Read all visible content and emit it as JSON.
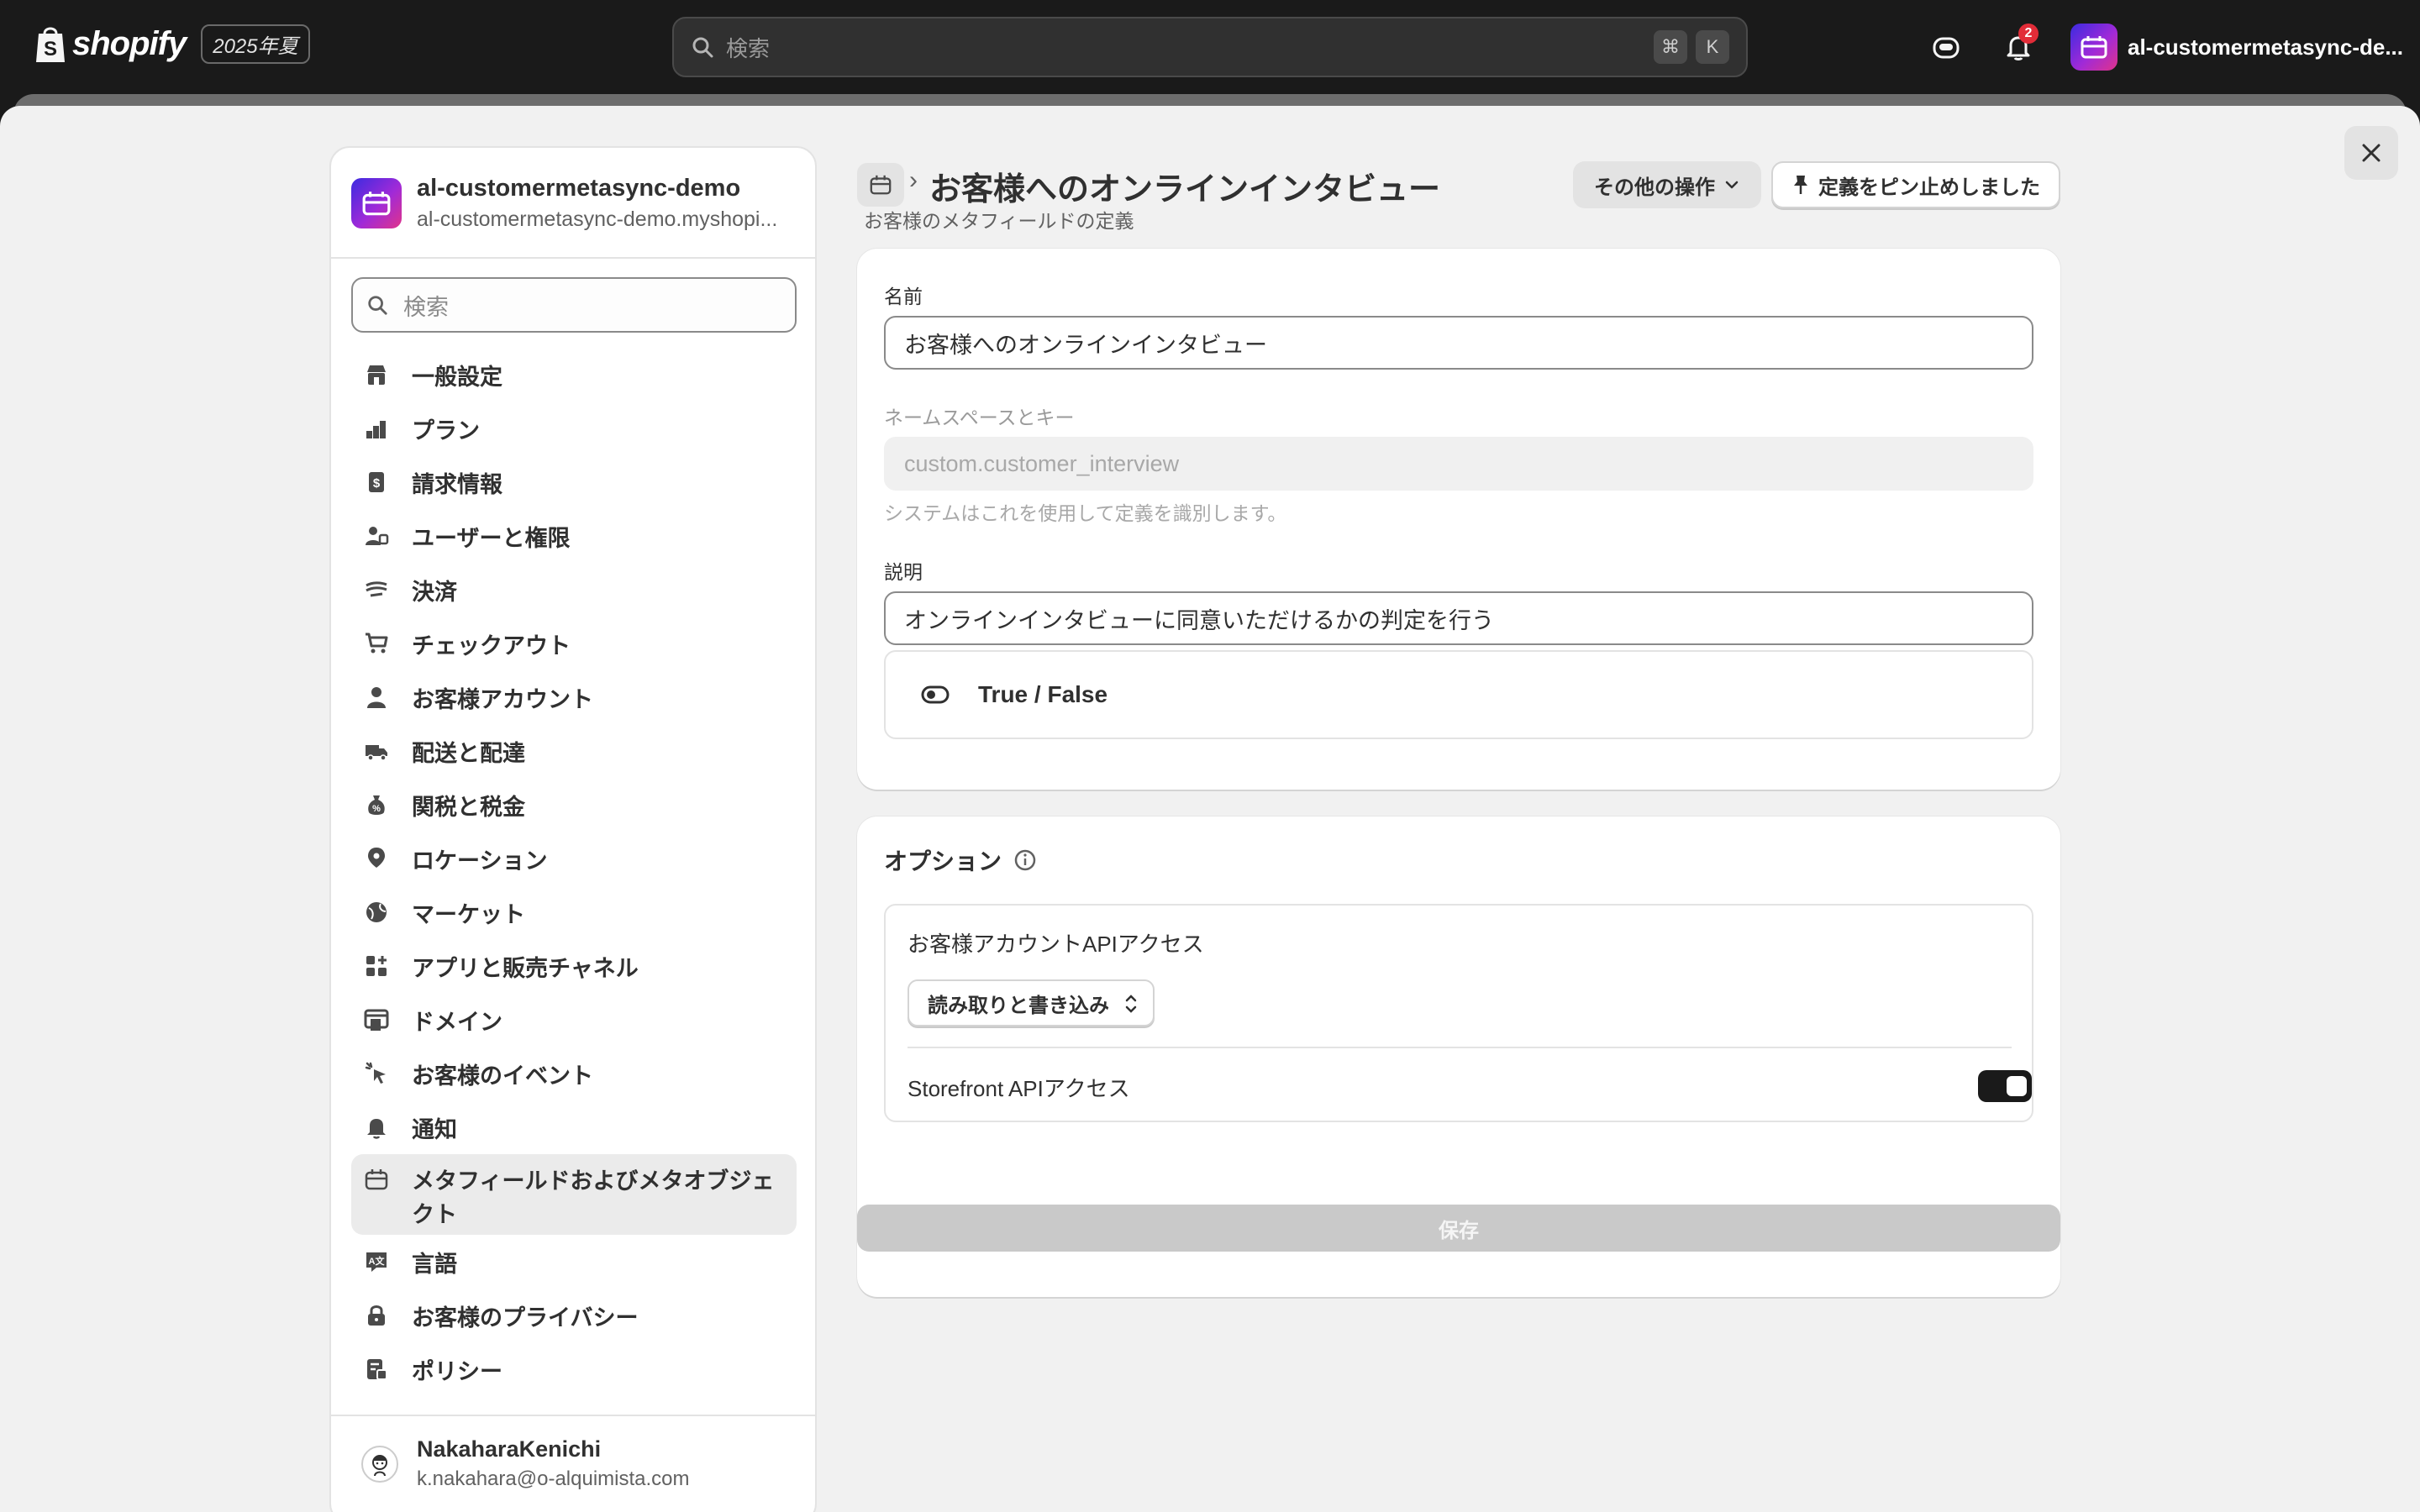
{
  "topbar": {
    "brand": "shopify",
    "edition": "2025年夏",
    "search_placeholder": "検索",
    "shortcut_cmd": "⌘",
    "shortcut_key": "K",
    "notification_count": "2",
    "store_name": "al-customermetasync-de..."
  },
  "sidebar": {
    "store_title": "al-customermetasync-demo",
    "store_domain": "al-customermetasync-demo.myshopi...",
    "search_placeholder": "検索",
    "items": [
      {
        "label": "一般設定",
        "icon": "store-icon"
      },
      {
        "label": "プラン",
        "icon": "plan-icon"
      },
      {
        "label": "請求情報",
        "icon": "billing-icon"
      },
      {
        "label": "ユーザーと権限",
        "icon": "users-icon"
      },
      {
        "label": "決済",
        "icon": "payments-icon"
      },
      {
        "label": "チェックアウト",
        "icon": "cart-icon"
      },
      {
        "label": "お客様アカウント",
        "icon": "person-icon"
      },
      {
        "label": "配送と配達",
        "icon": "truck-icon"
      },
      {
        "label": "関税と税金",
        "icon": "tax-icon"
      },
      {
        "label": "ロケーション",
        "icon": "location-icon"
      },
      {
        "label": "マーケット",
        "icon": "globe-icon"
      },
      {
        "label": "アプリと販売チャネル",
        "icon": "apps-icon"
      },
      {
        "label": "ドメイン",
        "icon": "domain-icon"
      },
      {
        "label": "お客様のイベント",
        "icon": "events-icon"
      },
      {
        "label": "通知",
        "icon": "bell-icon"
      },
      {
        "label": "メタフィールドおよびメタオブジェクト",
        "icon": "metafields-icon"
      },
      {
        "label": "言語",
        "icon": "language-icon"
      },
      {
        "label": "お客様のプライバシー",
        "icon": "lock-icon"
      },
      {
        "label": "ポリシー",
        "icon": "policy-icon"
      }
    ],
    "user_name": "NakaharaKenichi",
    "user_email": "k.nakahara@o-alquimista.com"
  },
  "header": {
    "title": "お客様へのオンラインインタビュー",
    "subtitle": "お客様のメタフィールドの定義",
    "more_actions": "その他の操作",
    "pin_label": "定義をピン止めしました"
  },
  "definition": {
    "name_label": "名前",
    "name_value": "お客様へのオンラインインタビュー",
    "namespace_label": "ネームスペースとキー",
    "namespace_value": "custom.customer_interview",
    "namespace_help": "システムはこれを使用して定義を識別します。",
    "description_label": "説明",
    "description_value": "オンラインインタビューに同意いただけるかの判定を行う",
    "type_name": "True / False"
  },
  "options": {
    "title": "オプション",
    "customer_api_label": "お客様アカウントAPIアクセス",
    "customer_api_value": "読み取りと書き込み",
    "storefront_api_label": "Storefront APIアクセス",
    "storefront_api_enabled": true
  },
  "save_label": "保存"
}
